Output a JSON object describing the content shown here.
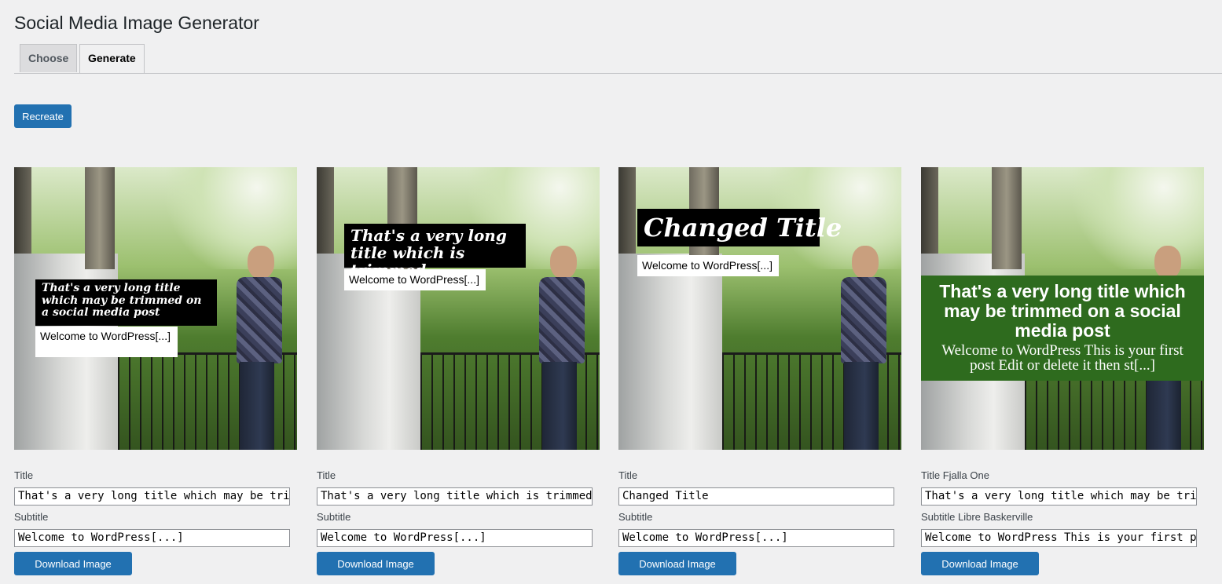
{
  "header": {
    "title": "Social Media Image Generator"
  },
  "tabs": [
    {
      "label": "Choose"
    },
    {
      "label": "Generate"
    }
  ],
  "actions": {
    "recreate_label": "Recreate"
  },
  "cards": [
    {
      "overlay_title": "That's a very long title which may be trimmed on a social media post",
      "overlay_subtitle": "Welcome to WordPress[...]",
      "title_label": "Title",
      "title_value": "That's a very long title which may be trimmed on a social media post",
      "subtitle_label": "Subtitle",
      "subtitle_value": "Welcome to WordPress[...]",
      "download_label": "Download Image"
    },
    {
      "overlay_title": "That's a very long title which is trimmed",
      "overlay_subtitle": "Welcome to WordPress[...]",
      "title_label": "Title",
      "title_value": "That's a very long title which is trimmed",
      "subtitle_label": "Subtitle",
      "subtitle_value": "Welcome to WordPress[...]",
      "download_label": "Download Image"
    },
    {
      "overlay_title": "Changed Title",
      "overlay_subtitle": "Welcome to WordPress[...]",
      "title_label": "Title",
      "title_value": "Changed Title",
      "subtitle_label": "Subtitle",
      "subtitle_value": "Welcome to WordPress[...]",
      "download_label": "Download Image"
    },
    {
      "overlay_title": "That's a very long title which may be trimmed on a social media post",
      "overlay_subtitle": "Welcome to WordPress This is your first post Edit or delete it then st[...]",
      "title_label": "Title Fjalla One",
      "title_value": "That's a very  long title which may be trimmed on a social media post",
      "subtitle_label": "Subtitle Libre Baskerville",
      "subtitle_value": "Welcome to WordPress This is your first post Edit or delete it then start writing!",
      "download_label": "Download Image"
    }
  ],
  "colors": {
    "primary_button": "#2271b1",
    "page_background": "#f0f0f1",
    "overlay_green": "#2e6b1e"
  }
}
